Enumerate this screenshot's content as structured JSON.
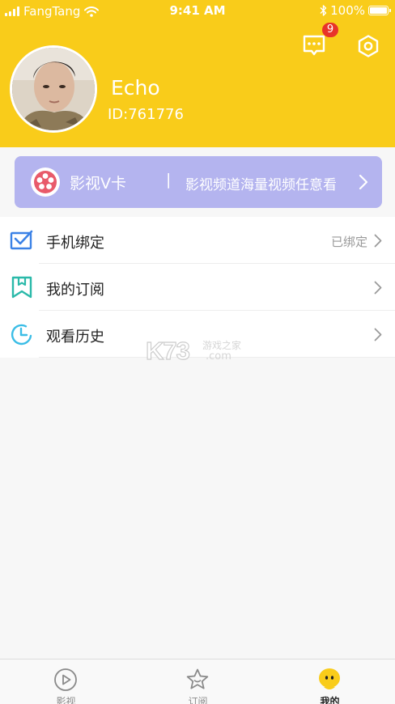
{
  "status_bar": {
    "carrier": "FangTang",
    "time": "9:41 AM",
    "battery": "100%"
  },
  "header": {
    "message_badge_count": "9",
    "username": "Echo",
    "user_id": "ID:761776",
    "icons": {
      "messages": "chat-bubble-icon",
      "settings": "settings-hexagon-icon"
    },
    "colors": {
      "background": "#f9cc1a",
      "badge": "#e8332a"
    }
  },
  "vcard": {
    "title": "影视V卡",
    "separator": "|",
    "description": "影视频道海量视频任意看",
    "colors": {
      "background": "#b4b4ef",
      "icon": "#e85a6a"
    }
  },
  "menu": [
    {
      "label": "手机绑定",
      "value": "已绑定",
      "icon": "checkbox-mail-icon",
      "icon_color": "#3b82e6"
    },
    {
      "label": "我的订阅",
      "value": "",
      "icon": "bookmark-icon",
      "icon_color": "#2ab9a9"
    },
    {
      "label": "观看历史",
      "value": "",
      "icon": "clock-icon",
      "icon_color": "#3bbde6"
    }
  ],
  "watermark": {
    "brand": "K73",
    "chinese": "游戏之家",
    "domain": ".com"
  },
  "tabbar": {
    "tabs": [
      {
        "label": "影视",
        "icon": "play-circle-icon",
        "active": false
      },
      {
        "label": "订阅",
        "icon": "star-icon",
        "active": false
      },
      {
        "label": "我的",
        "icon": "mascot-face-icon",
        "active": true
      }
    ],
    "active_color": "#f9cc1a"
  }
}
